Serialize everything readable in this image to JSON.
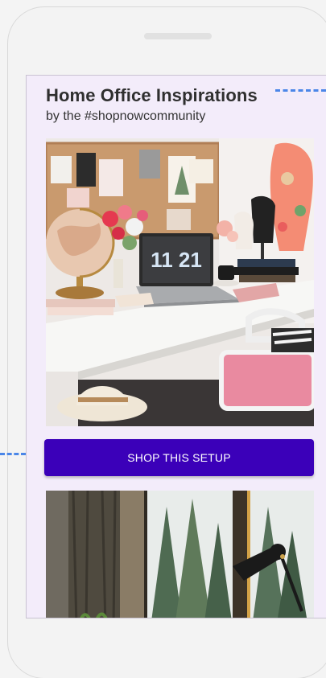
{
  "header": {
    "title": "Home Office Inspirations",
    "subtitle": "by the #shopnowcommunity"
  },
  "feed": {
    "cta_label": "SHOP THIS SETUP",
    "laptop_clock": "11 21"
  },
  "colors": {
    "accent": "#3b00b9",
    "screen_bg": "#f3ecfa",
    "guide_line": "#4a86e8"
  }
}
